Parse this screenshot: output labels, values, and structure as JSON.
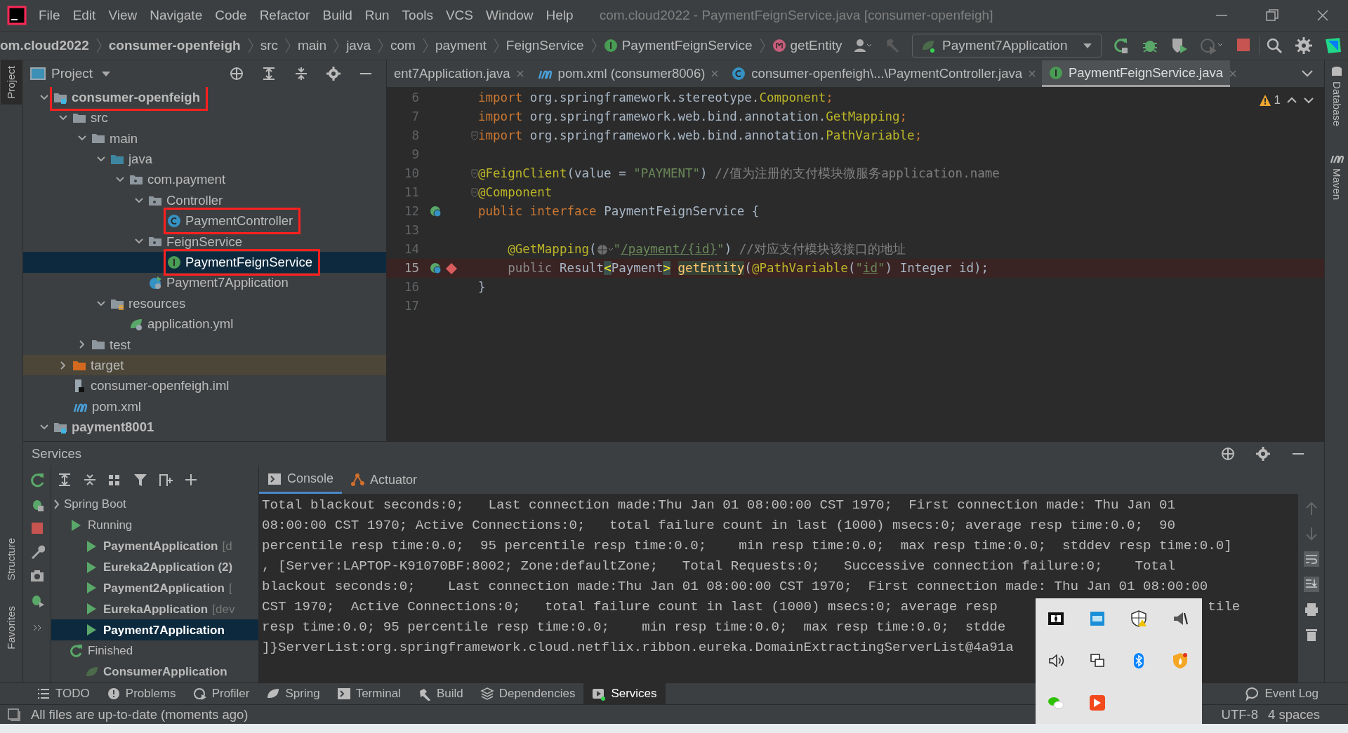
{
  "window": {
    "title": "com.cloud2022 - PaymentFeignService.java [consumer-openfeigh]"
  },
  "menu": [
    "File",
    "Edit",
    "View",
    "Navigate",
    "Code",
    "Refactor",
    "Build",
    "Run",
    "Tools",
    "VCS",
    "Window",
    "Help"
  ],
  "breadcrumb": [
    {
      "label": "om.cloud2022",
      "kind": "project"
    },
    {
      "label": "consumer-openfeigh",
      "kind": "module"
    },
    {
      "label": "src",
      "kind": "folder"
    },
    {
      "label": "main",
      "kind": "folder"
    },
    {
      "label": "java",
      "kind": "folder"
    },
    {
      "label": "com",
      "kind": "folder"
    },
    {
      "label": "payment",
      "kind": "folder"
    },
    {
      "label": "FeignService",
      "kind": "folder"
    },
    {
      "label": "PaymentFeignService",
      "kind": "interface"
    },
    {
      "label": "getEntity",
      "kind": "method"
    }
  ],
  "run_config": {
    "label": "Payment7Application"
  },
  "left_strip": [
    "Project",
    "Structure",
    "Favorites"
  ],
  "right_strip": [
    "Database",
    "Maven"
  ],
  "project_panel": {
    "title": "Project"
  },
  "project_tree": [
    {
      "label": "consumer-openfeigh",
      "kind": "module",
      "bold": true,
      "annotated": true,
      "selected": false,
      "expanded": true,
      "children": [
        {
          "label": "src",
          "kind": "folder",
          "annotated": false,
          "selected": false,
          "expanded": true,
          "children": [
            {
              "label": "main",
              "kind": "folder",
              "annotated": false,
              "selected": false,
              "expanded": true,
              "children": [
                {
                  "label": "java",
                  "kind": "source-folder",
                  "annotated": false,
                  "selected": false,
                  "expanded": true,
                  "children": [
                    {
                      "label": "com.payment",
                      "kind": "package",
                      "annotated": false,
                      "selected": false,
                      "expanded": true,
                      "children": [
                        {
                          "label": "Controller",
                          "kind": "package",
                          "annotated": false,
                          "selected": false,
                          "expanded": true,
                          "children": [
                            {
                              "label": "PaymentController",
                              "kind": "class",
                              "annotated": true,
                              "selected": false
                            }
                          ]
                        },
                        {
                          "label": "FeignService",
                          "kind": "package",
                          "annotated": false,
                          "selected": false,
                          "expanded": true,
                          "children": [
                            {
                              "label": "PaymentFeignService",
                              "kind": "interface",
                              "annotated": true,
                              "selected": true
                            }
                          ]
                        },
                        {
                          "label": "Payment7Application",
                          "kind": "spring-app",
                          "annotated": false,
                          "selected": false
                        }
                      ]
                    }
                  ]
                },
                {
                  "label": "resources",
                  "kind": "resources",
                  "annotated": false,
                  "selected": false,
                  "expanded": true,
                  "children": [
                    {
                      "label": "application.yml",
                      "kind": "yml",
                      "annotated": false,
                      "selected": false
                    }
                  ]
                }
              ]
            },
            {
              "label": "test",
              "kind": "folder",
              "annotated": false,
              "selected": false,
              "expanded": false
            }
          ]
        },
        {
          "label": "target",
          "kind": "excluded-folder",
          "annotated": false,
          "selected": false,
          "expanded": false
        },
        {
          "label": "consumer-openfeigh.iml",
          "kind": "iml",
          "annotated": false,
          "selected": false
        },
        {
          "label": "pom.xml",
          "kind": "maven",
          "annotated": false,
          "selected": false
        }
      ]
    },
    {
      "label": "payment8001",
      "kind": "module",
      "bold": true,
      "annotated": false,
      "selected": false,
      "expanded": true
    }
  ],
  "editor_tabs": [
    {
      "label": "ent7Application.java",
      "kind": "plain",
      "selected": false
    },
    {
      "label": "pom.xml (consumer8006)",
      "kind": "maven",
      "selected": false
    },
    {
      "label": "consumer-openfeigh\\...\\PaymentController.java",
      "kind": "class",
      "selected": false
    },
    {
      "label": "PaymentFeignService.java",
      "kind": "interface",
      "selected": true
    }
  ],
  "inspection": {
    "count": "1"
  },
  "code": [
    {
      "number": "6",
      "tokens": [
        {
          "t": "import ",
          "kind": "kw"
        },
        {
          "t": "org.springframework.stereotype.",
          "kind": "plain"
        },
        {
          "t": "Component",
          "kind": "ann"
        },
        {
          "t": ";",
          "kind": "kw"
        }
      ]
    },
    {
      "number": "7",
      "tokens": [
        {
          "t": "import ",
          "kind": "kw"
        },
        {
          "t": "org.springframework.web.bind.annotation.",
          "kind": "plain"
        },
        {
          "t": "GetMapping",
          "kind": "ann"
        },
        {
          "t": ";",
          "kind": "kw"
        }
      ]
    },
    {
      "number": "8",
      "fold": true,
      "tokens": [
        {
          "t": "import ",
          "kind": "kw"
        },
        {
          "t": "org.springframework.web.bind.annotation.",
          "kind": "plain"
        },
        {
          "t": "PathVariable",
          "kind": "ann"
        },
        {
          "t": ";",
          "kind": "kw"
        }
      ]
    },
    {
      "number": "9"
    },
    {
      "number": "10",
      "fold": true,
      "tokens": [
        {
          "t": "@FeignClient",
          "kind": "ann"
        },
        {
          "t": "(value = ",
          "kind": "plain"
        },
        {
          "t": "\"PAYMENT\"",
          "kind": "str"
        },
        {
          "t": ") ",
          "kind": "plain"
        },
        {
          "t": "//值为注册的支付模块微服务application.name",
          "kind": "comment"
        }
      ]
    },
    {
      "number": "11",
      "fold": true,
      "tokens": [
        {
          "t": "@Component",
          "kind": "ann"
        }
      ]
    },
    {
      "number": "12",
      "implemented": true,
      "tokens": [
        {
          "t": "public interface ",
          "kind": "kw"
        },
        {
          "t": "PaymentFeignService {",
          "kind": "plain"
        }
      ]
    },
    {
      "number": "13"
    },
    {
      "number": "14",
      "tokens": [
        {
          "t": "    @GetMapping",
          "kind": "ann"
        },
        {
          "t": "(",
          "kind": "plain"
        },
        {
          "kind": "globe"
        },
        {
          "t": "\"",
          "kind": "str"
        },
        {
          "t": "/payment/{id}",
          "kind": "link"
        },
        {
          "t": "\"",
          "kind": "str"
        },
        {
          "t": ") ",
          "kind": "plain"
        },
        {
          "t": "//对应支付模块该接口的地址",
          "kind": "comment"
        }
      ]
    },
    {
      "number": "15",
      "implemented": true,
      "breakpoint": true,
      "tokens": [
        {
          "t": "    public ",
          "kind": "muted"
        },
        {
          "t": "Result",
          "kind": "plain"
        },
        {
          "t": "<",
          "kind": "brace"
        },
        {
          "t": "Payment",
          "kind": "plain"
        },
        {
          "t": ">",
          "kind": "brace"
        },
        {
          "t": " getEntity",
          "kind": "method"
        },
        {
          "t": "(",
          "kind": "plain"
        },
        {
          "t": "@PathVariable",
          "kind": "ann"
        },
        {
          "t": "(",
          "kind": "plain"
        },
        {
          "t": "\"",
          "kind": "str"
        },
        {
          "t": "id",
          "kind": "link"
        },
        {
          "t": "\"",
          "kind": "str"
        },
        {
          "t": ") Integer id);",
          "kind": "plain"
        }
      ]
    },
    {
      "number": "16",
      "tokens": [
        {
          "t": "}",
          "kind": "plain"
        }
      ]
    },
    {
      "number": "17"
    }
  ],
  "services": {
    "title": "Services",
    "tree": [
      {
        "label": "Spring Boot",
        "kind": "group",
        "selected": false,
        "children": [
          {
            "label": "Running",
            "kind": "running",
            "selected": false,
            "children": [
              {
                "label": "PaymentApplication",
                "suffix": "[d",
                "kind": "app",
                "selected": false
              },
              {
                "label": "Eureka2Application (2)",
                "kind": "app",
                "selected": false
              },
              {
                "label": "Payment2Application",
                "suffix": "[",
                "kind": "app",
                "selected": false
              },
              {
                "label": "EurekaApplication",
                "suffix": "[dev",
                "kind": "app",
                "selected": false
              },
              {
                "label": "Payment7Application",
                "kind": "app",
                "selected": true
              }
            ]
          },
          {
            "label": "Finished",
            "kind": "finished",
            "selected": false,
            "children": [
              {
                "label": "ConsumerApplication",
                "kind": "finished-app",
                "selected": false
              }
            ]
          }
        ]
      }
    ],
    "tabs": [
      {
        "label": "Console",
        "kind": "console",
        "selected": true
      },
      {
        "label": "Actuator",
        "kind": "actuator",
        "selected": false
      }
    ],
    "console": [
      [
        {
          "text": "Total blackout seconds:0;   Last connection made:Thu Jan 01 08:00:00 CST 1970;  First connection made: Thu Jan 01"
        }
      ],
      [
        {
          "text": "08:00:00 CST 1970; Active Connections:0;   total failure count in last (1000) msecs:0; average resp time:0.0;  90"
        }
      ],
      [
        {
          "text": "percentile resp time:0.0;  95 percentile resp time:0.0;    min resp time:0.0;  max resp time:0.0;  stddev resp time:0.0]"
        }
      ],
      [
        {
          "text": ", [Server:LAPTOP-K91070BF:8002; Zone:defaultZone;   Total Requests:0;   Successive connection failure:0;    Total"
        }
      ],
      [
        {
          "text": "blackout seconds:0;    Last connection made:Thu Jan 01 08:00:00 CST 1970;  First connection made: Thu Jan 01 08:00:00"
        }
      ],
      [
        {
          "text": "CST 1970;  Active Connections:0;   total failure count in last (1000) msecs:0; average resp"
        },
        {
          "text": "tile"
        }
      ],
      [
        {
          "text": "resp time:0.0; 95 percentile resp time:0.0;    min resp time:0.0;  max resp time:0.0;  stdde"
        }
      ],
      [
        {
          "text": "]}ServerList:org.springframework.cloud.netflix.ribbon.eureka.DomainExtractingServerList@4a91a"
        }
      ]
    ]
  },
  "tool_tabs": [
    {
      "label": "TODO",
      "kind": "list",
      "selected": false
    },
    {
      "label": "Problems",
      "kind": "problems",
      "selected": false
    },
    {
      "label": "Profiler",
      "kind": "profiler",
      "selected": false
    },
    {
      "label": "Spring",
      "kind": "spring",
      "selected": false
    },
    {
      "label": "Terminal",
      "kind": "terminal",
      "selected": false
    },
    {
      "label": "Build",
      "kind": "build",
      "selected": false
    },
    {
      "label": "Dependencies",
      "kind": "dependencies",
      "selected": false
    },
    {
      "label": "Services",
      "kind": "services",
      "selected": true
    }
  ],
  "event_log": {
    "label": "Event Log"
  },
  "status_bar": {
    "message": "All files are up-to-date (moments ago)",
    "encoding": "UTF-8",
    "indent": "4 spaces"
  },
  "tray_popup": {
    "icons": [
      {
        "kind": "dolby"
      },
      {
        "kind": "intel"
      },
      {
        "kind": "security"
      },
      {
        "kind": "speaker-app"
      },
      {
        "kind": "volume"
      },
      {
        "kind": "display"
      },
      {
        "kind": "bluetooth"
      },
      {
        "kind": "shield-app"
      },
      {
        "kind": "wechat"
      },
      {
        "kind": "media-app"
      }
    ]
  }
}
